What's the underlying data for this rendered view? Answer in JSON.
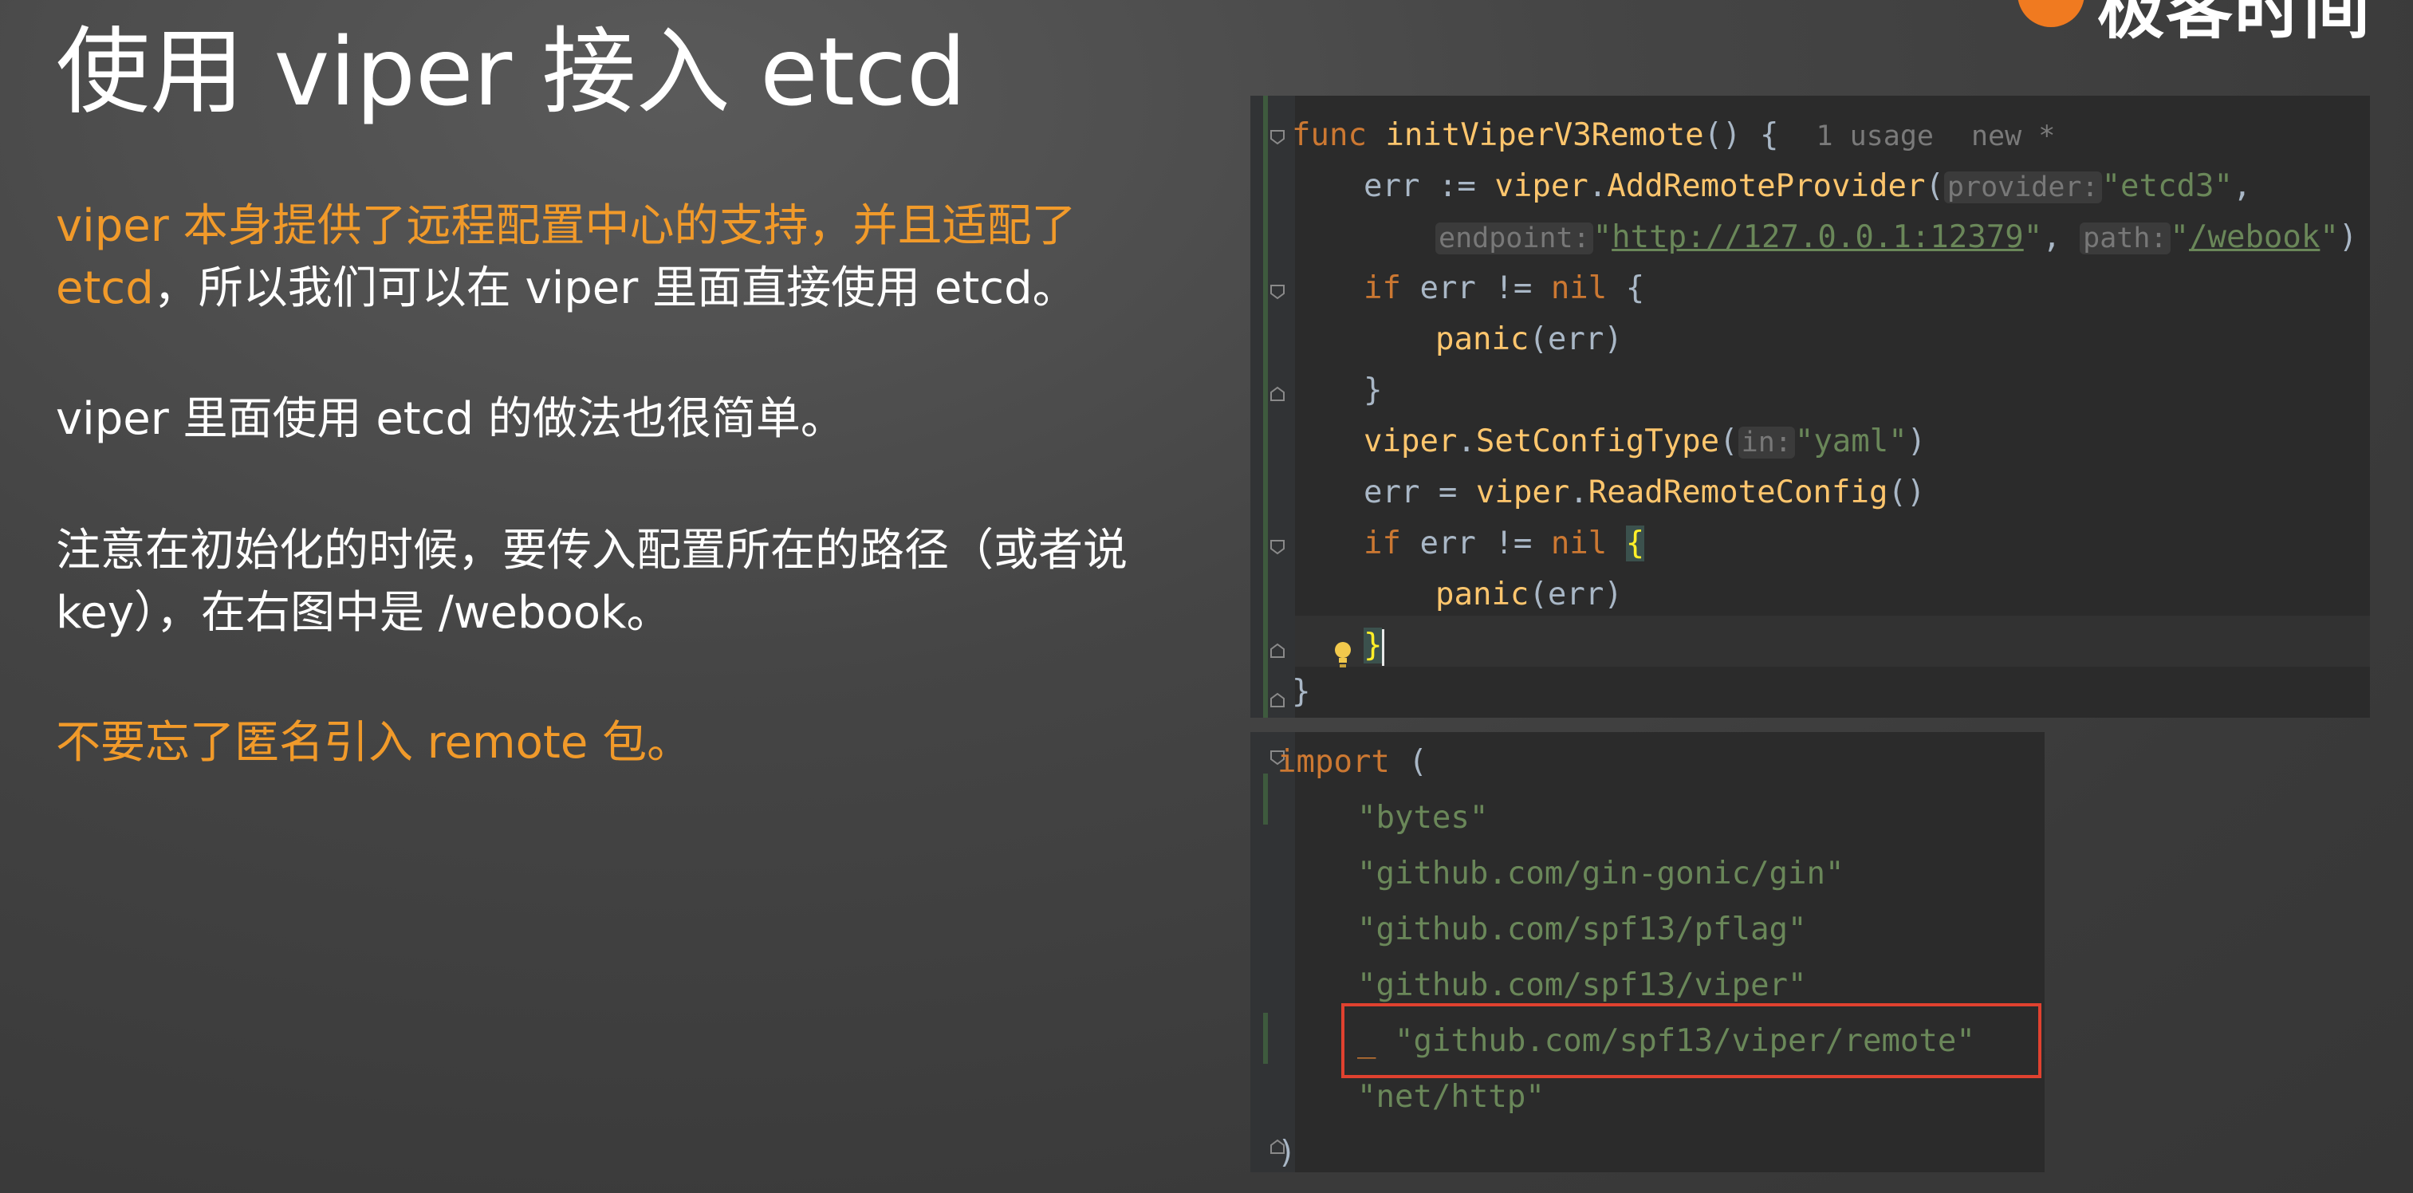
{
  "brand": {
    "logo_text": "极客时间"
  },
  "slide": {
    "title": "使用 viper 接入 etcd",
    "p1_orange": "viper 本身提供了远程配置中心的支持，并且适配了 etcd",
    "p1_rest": "，所以我们可以在 viper 里面直接使用 etcd。",
    "p2": "viper 里面使用 etcd 的做法也很简单。",
    "p3": "注意在初始化的时候，要传入配置所在的路径（或者说 key），在右图中是 /webook。",
    "p4": "不要忘了匿名引入 remote 包。"
  },
  "code_top": {
    "func_kw": "func",
    "func_name": "initViperV3Remote",
    "func_tail": "() {",
    "usage": "1 usage",
    "new_hint": "new *",
    "l2_a": "err := ",
    "l2_pkg": "viper",
    "l2_dot": ".",
    "l2_call": "AddRemoteProvider",
    "l2_paren": "(",
    "hint_provider": "provider:",
    "str_etcd3": "\"etcd3\"",
    "comma": ",",
    "hint_endpoint": "endpoint:",
    "url": "http://127.0.0.1:12379",
    "hint_path": "path:",
    "path_val": "/webook",
    "close_paren": ")",
    "if_kw": "if",
    "if_mid": " err != ",
    "nil_kw": "nil",
    "open_brace": " {",
    "panic": "panic",
    "panic_arg": "(err)",
    "close_brace": "}",
    "l7_call": "SetConfigType",
    "hint_in": "in:",
    "str_yaml": "\"yaml\"",
    "l8_a": "err = ",
    "l8_call": "ReadRemoteConfig",
    "l8_tail": "()",
    "brace_open_hl": "{"
  },
  "code_bot": {
    "import_kw": "import",
    "import_paren": " (",
    "imports": [
      "\"bytes\"",
      "\"github.com/gin-gonic/gin\"",
      "\"github.com/spf13/pflag\"",
      "\"github.com/spf13/viper\"",
      "\"github.com/spf13/viper/remote\"",
      "\"net/http\""
    ],
    "blank": "_ ",
    "close": ")"
  },
  "icons": [
    "fold-icon",
    "lightbulb-icon"
  ],
  "colors": {
    "accent_orange": "#f19a2a",
    "highlight_border": "#e0412f",
    "editor_bg": "#2b2b2b"
  }
}
